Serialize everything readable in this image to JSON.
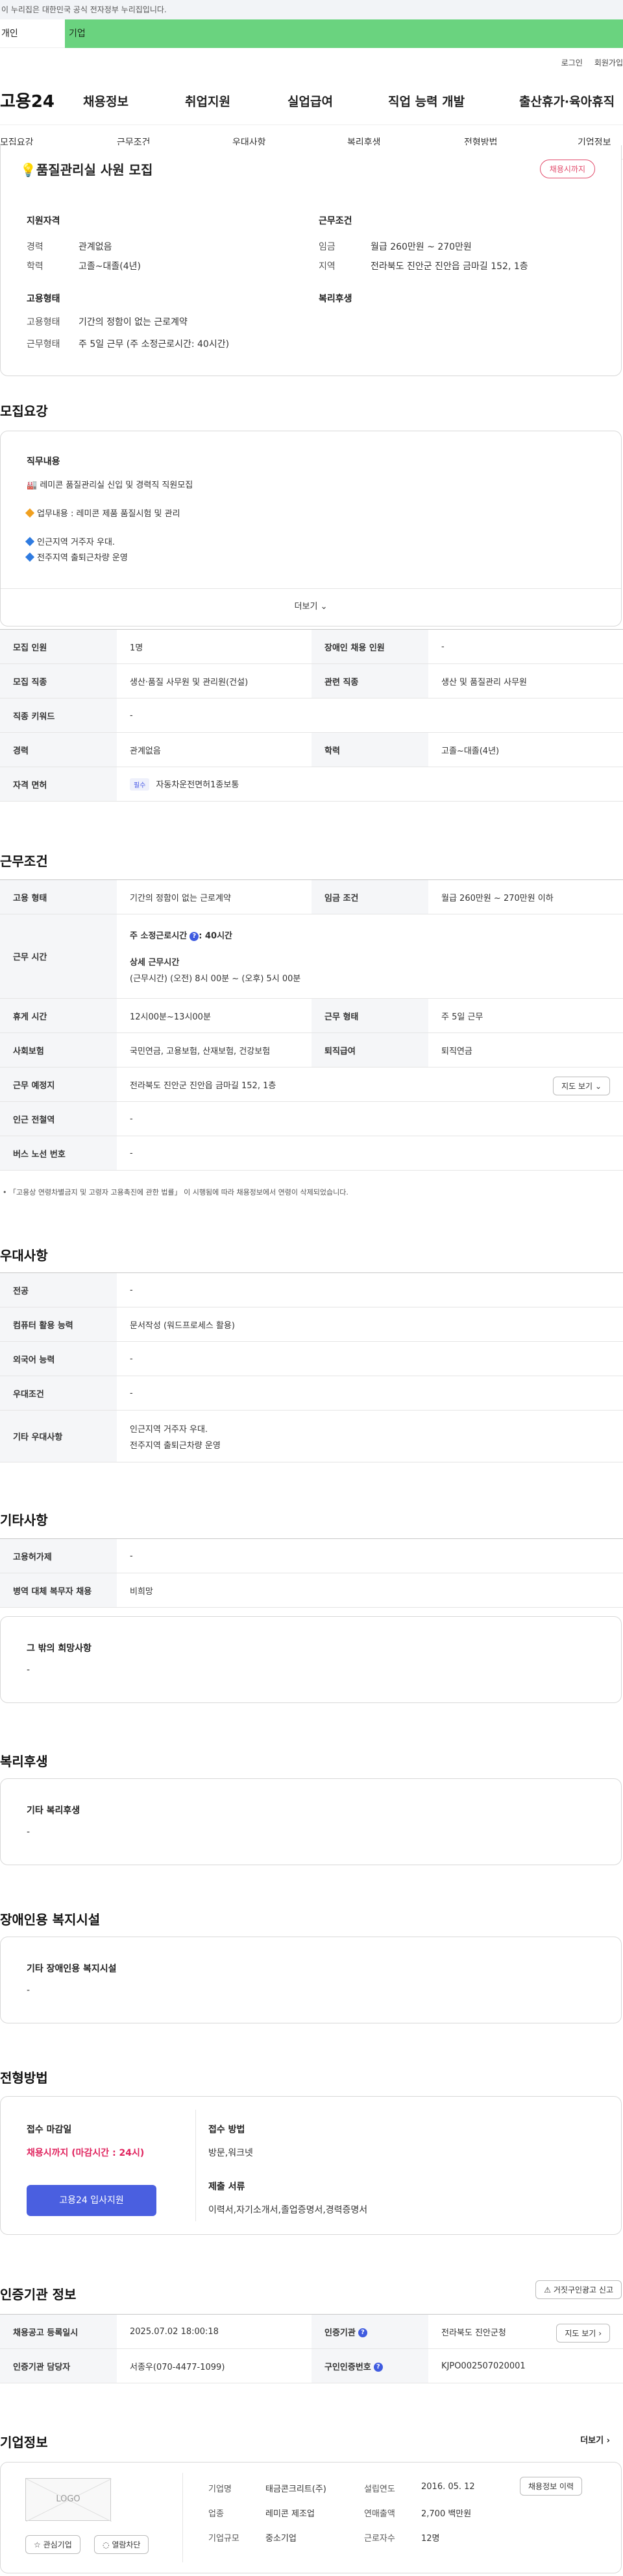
{
  "gov": {
    "text": "이 누리집은 대한민국 공식 전자정부 누리집입니다.",
    "tab1": "개인",
    "tab2": "기업"
  },
  "util": {
    "login": "로그인",
    "join": "회원가입"
  },
  "gnb": {
    "logo": "고용24",
    "items": [
      "채용정보",
      "취업지원",
      "실업급여",
      "직업 능력 개발",
      "출산휴가·육아휴직"
    ]
  },
  "subnav": [
    "모집요강",
    "근무조건",
    "우대사항",
    "복리후생",
    "전형방법",
    "기업정보"
  ],
  "job": {
    "title": "품질관리실 사원 모집",
    "badge": "채용시까지",
    "qual_h": "지원자격",
    "career_l": "경력",
    "career_v": "관계없음",
    "edu_l": "학력",
    "edu_v": "고졸~대졸(4년)",
    "emp_h": "고용형태",
    "emptype_l": "고용형태",
    "emptype_v": "기간의 정함이 없는 근로계약",
    "worktype_l": "근무형태",
    "worktype_v": "주 5일 근무 (주 소정근로시간: 40시간)",
    "cond_h": "근무조건",
    "wage_l": "임금",
    "wage_v": "월급 260만원 ~ 270만원",
    "area_l": "지역",
    "area_v": "전라북도 진안군 진안읍 금마길 152, 1층",
    "welfare_h": "복리후생"
  },
  "recruit": {
    "title": "모집요강",
    "duty_h": "직무내용",
    "line1": "🏭 레미콘 품질관리실 신입 및 경력직 직원모집",
    "line2": "업무내용 : 레미콘 제품 품질시험 및 관리",
    "line3": "인근지역 거주자 우대.",
    "line4": "전주지역 출퇴근차량 운영",
    "more": "더보기",
    "rows": {
      "k1": "모집 인원",
      "v1": "1명",
      "k2": "장애인 채용 인원",
      "v2": "-",
      "k3": "모집 직종",
      "v3": "생산·품질 사무원 및 관리원(건설)",
      "k4": "관련 직종",
      "v4": "생산 및 품질관리 사무원",
      "k5": "직종 키워드",
      "v5": "-",
      "k6": "경력",
      "v6": "관계없음",
      "k7": "학력",
      "v7": "고졸~대졸(4년)",
      "k8": "자격 면허",
      "tag": "필수",
      "v8": "자동차운전면허1종보통"
    }
  },
  "cond": {
    "title": "근무조건",
    "k1": "고용 형태",
    "v1": "기간의 정함이 없는 근로계약",
    "k2": "임금 조건",
    "v2": "월급 260만원 ~ 270만원 이하",
    "k3": "근무 시간",
    "v3a": "주 소정근로시간",
    "v3b": ": 40시간",
    "v3c": "상세 근무시간",
    "v3d": "(근무시간) (오전) 8시 00분 ~ (오후) 5시 00분",
    "k4": "휴게 시간",
    "v4": "12시00분~13시00분",
    "k5": "근무 형태",
    "v5": "주 5일 근무",
    "k6": "사회보험",
    "v6": "국민연금, 고용보험, 산재보험, 건강보험",
    "k7": "퇴직급여",
    "v7": "퇴직연금",
    "k8": "근무 예정지",
    "v8": "전라북도 진안군 진안읍 금마길 152, 1층",
    "map": "지도 보기",
    "k9": "인근 전철역",
    "v9": "-",
    "k10": "버스 노선 번호",
    "v10": "-",
    "note": "「고용상 연령차별금지 및 고령자 고용촉진에 관한 법률」 이 시행됨에 따라 채용정보에서 연령이 삭제되었습니다."
  },
  "pref": {
    "title": "우대사항",
    "k1": "전공",
    "v1": "-",
    "k2": "컴퓨터 활용 능력",
    "v2": "문서작성 (워드프로세스 활용)",
    "k3": "외국어 능력",
    "v3": "-",
    "k4": "우대조건",
    "v4": "-",
    "k5": "기타 우대사항",
    "v5a": "인근지역 거주자 우대.",
    "v5b": "전주지역 출퇴근차량 운영"
  },
  "etc": {
    "title": "기타사항",
    "k1": "고용허가제",
    "v1": "-",
    "k2": "병역 대체 복무자 채용",
    "v2": "비희망",
    "hope_h": "그 밖의 희망사항",
    "hope_v": "-"
  },
  "welfare": {
    "title": "복리후생",
    "h": "기타 복리후생",
    "v": "-"
  },
  "disab": {
    "title": "장애인용 복지시설",
    "h": "기타 장애인용 복지시설",
    "v": "-"
  },
  "process": {
    "title": "전형방법",
    "deadline_h": "접수 마감일",
    "deadline_v": "채용시까지 (마감시간 : 24시)",
    "apply": "고용24 입사지원",
    "method_h": "접수 방법",
    "method_v": "방문,워크넷",
    "docs_h": "제출 서류",
    "docs_v": "이력서,자기소개서,졸업증명서,경력증명서"
  },
  "cert": {
    "title": "인증기관 정보",
    "report": "거짓구인광고 신고",
    "k1": "채용공고 등록일시",
    "v1": "2025.07.02 18:00:18",
    "k2": "인증기관",
    "v2": "전라북도 진안군청",
    "map": "지도 보기",
    "k3": "인증기관 담당자",
    "v3": "서종우(070-4477-1099)",
    "k4": "구인인증번호",
    "v4": "KJPO002507020001"
  },
  "company": {
    "title": "기업정보",
    "more": "더보기",
    "logo": "LOGO",
    "fav": "관심기업",
    "block": "열람차단",
    "k1": "기업명",
    "v1": "태금콘크리트(주)",
    "k2": "설립연도",
    "v2": "2016. 05. 12",
    "k3": "업종",
    "v3": "레미콘 제조업",
    "k4": "연매출액",
    "v4": "2,700 백만원",
    "k5": "기업규모",
    "v5": "중소기업",
    "k6": "근로자수",
    "v6": "12명",
    "history": "채용정보 이력"
  },
  "colors": {
    "accent": "#4a5fe0",
    "green": "#6ad37f",
    "red": "#e24b6b"
  }
}
